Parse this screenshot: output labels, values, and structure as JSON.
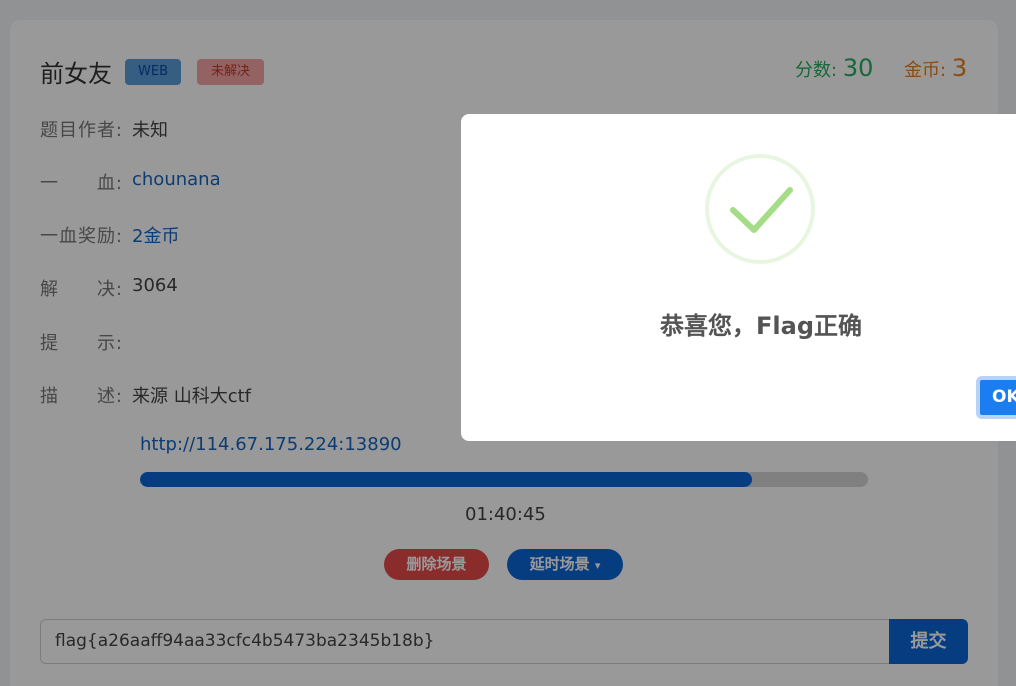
{
  "challenge": {
    "title": "前女友",
    "category_badge": "WEB",
    "status_badge": "未解决",
    "score_label": "分数:",
    "score_value": "30",
    "coin_label": "金币:",
    "coin_value": "3"
  },
  "details": [
    {
      "label": "题目作者:",
      "value": "未知",
      "is_link": false
    },
    {
      "label": "一　　血:",
      "value": "chounana",
      "is_link": true
    },
    {
      "label": "一血奖励:",
      "value": "2金币",
      "is_link": true
    },
    {
      "label": "解　　决:",
      "value": "3064",
      "is_link": false
    },
    {
      "label": "提　　示:",
      "value": "",
      "is_link": false
    },
    {
      "label": "描　　述:",
      "value": "来源 山科大ctf",
      "is_link": false
    }
  ],
  "scene": {
    "url": "http://114.67.175.224:13890",
    "progress_fraction": 0.84,
    "timer": "01:40:45",
    "delete_label": "删除场景",
    "extend_label": "延时场景",
    "extend_caret": "▾"
  },
  "flag_form": {
    "value": "flag{a26aaff94aa33cfc4b5473ba2345b18b}",
    "submit_label": "提交"
  },
  "modal": {
    "icon": "success-check-icon",
    "message": "恭喜您，Flag正确",
    "ok_label": "OK"
  },
  "colors": {
    "accent_blue": "#0a66d6",
    "danger_red": "#e84a4a",
    "score_green": "#27ae60",
    "coin_orange": "#e67e22",
    "success_green": "#a5dc86"
  }
}
